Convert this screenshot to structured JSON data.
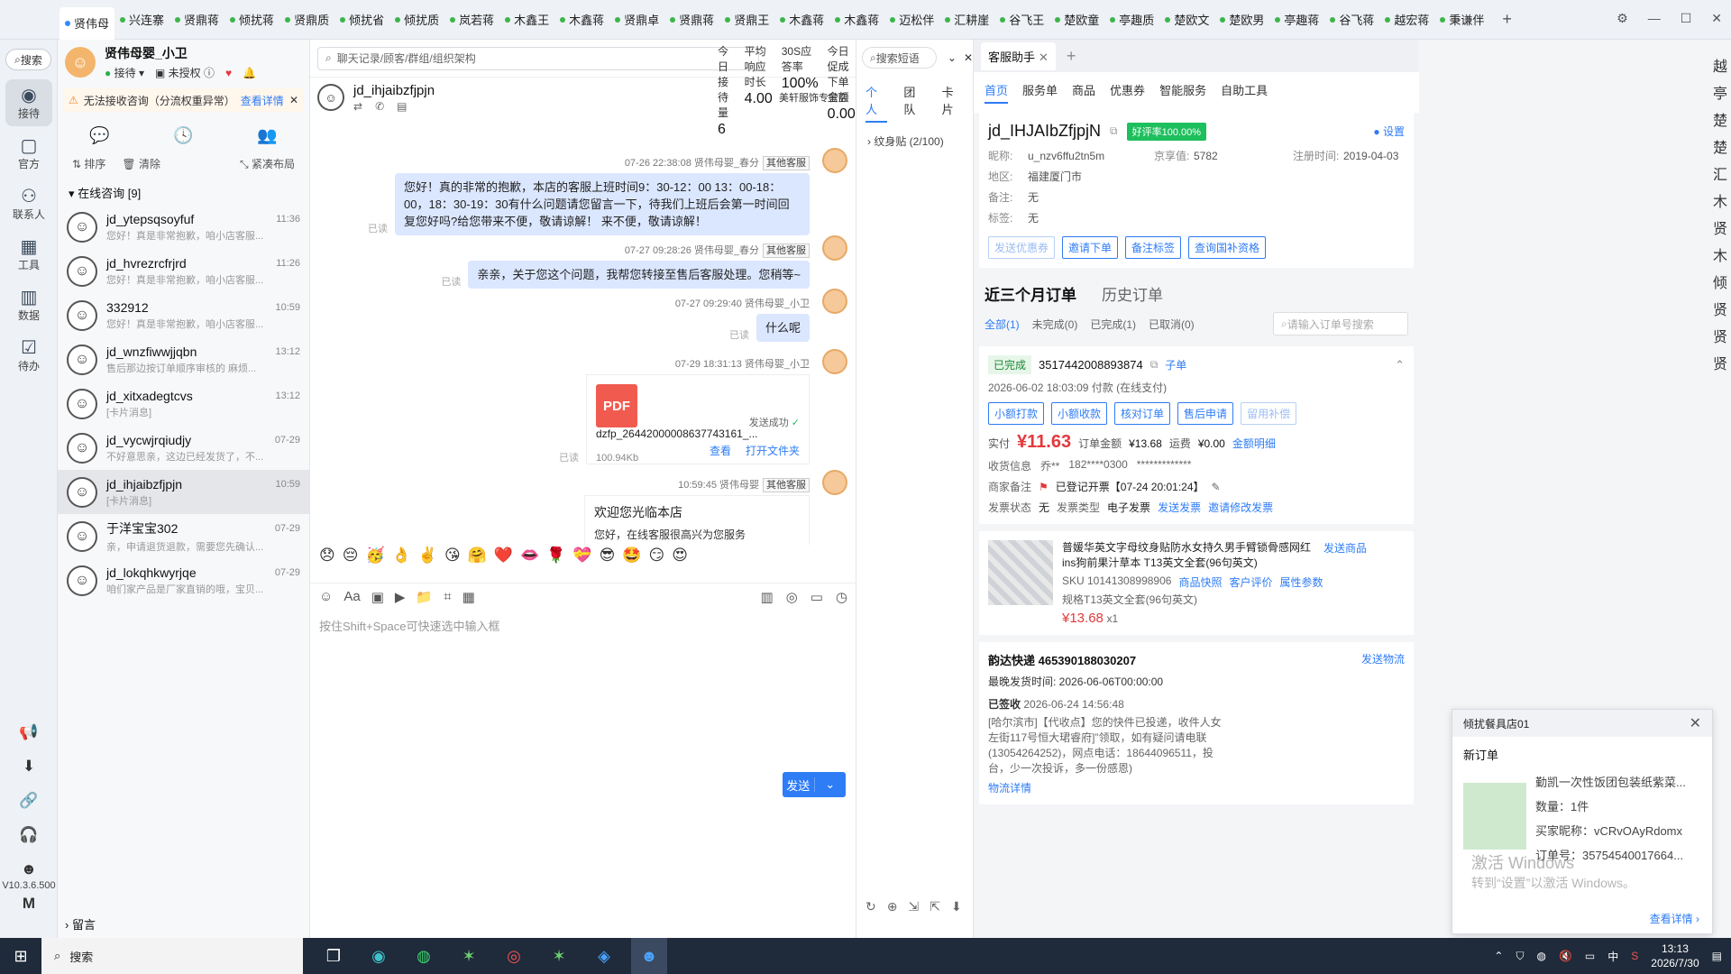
{
  "top_tabs": [
    "贤伟母",
    "兴连寨",
    "贤鼎蒋",
    "倾扰蒋",
    "贤鼎质",
    "倾扰省",
    "倾扰质",
    "岚若蒋",
    "木鑫王",
    "木鑫蒋",
    "贤鼎卓",
    "贤鼎蒋",
    "贤鼎王",
    "木鑫蒋",
    "木鑫蒋",
    "迈松伴",
    "汇耕崖",
    "谷飞王",
    "楚欧童",
    "亭趣质",
    "楚欧文",
    "楚欧男",
    "亭趣蒋",
    "谷飞蒋",
    "越宏蒋",
    "秉谦伴"
  ],
  "nav": {
    "search": "搜索",
    "items": [
      {
        "label": "接待",
        "icon": "chat-bubble-icon"
      },
      {
        "label": "官方",
        "icon": "message-icon"
      },
      {
        "label": "联系人",
        "icon": "person-icon"
      },
      {
        "label": "工具",
        "icon": "grid-icon"
      },
      {
        "label": "数据",
        "icon": "bar-chart-icon"
      },
      {
        "label": "待办",
        "icon": "checkbox-icon"
      }
    ],
    "version": "V10.3.6.500"
  },
  "me": {
    "name": "贤伟母婴_小卫",
    "status": "接待",
    "auth": "未授权"
  },
  "warning": {
    "text": "无法接收咨询（分流权重异常）",
    "link": "查看详情"
  },
  "list_tools": {
    "sort": "排序",
    "clear": "清除",
    "layout": "紧凑布局"
  },
  "online_group": "在线咨询 [9]",
  "conversations": [
    {
      "name": "jd_ytepsqsoyfuf",
      "time": "11:36",
      "preview": "您好！真是非常抱歉，咱小店客服..."
    },
    {
      "name": "jd_hvrezrcfrjrd",
      "time": "11:26",
      "preview": "您好！真是非常抱歉，咱小店客服..."
    },
    {
      "name": "332912",
      "time": "10:59",
      "preview": "您好！真是非常抱歉，咱小店客服..."
    },
    {
      "name": "jd_wnzfiwwjjqbn",
      "time": "13:12",
      "preview": "售后那边按订单顺序审核的 麻烦..."
    },
    {
      "name": "jd_xitxadegtcvs",
      "time": "13:12",
      "preview": "[卡片消息]"
    },
    {
      "name": "jd_vycwjrqiudjy",
      "time": "07-29",
      "preview": "不好意思亲，这边已经发货了，不..."
    },
    {
      "name": "jd_ihjaibzfjpjn",
      "time": "10:59",
      "preview": "[卡片消息]"
    },
    {
      "name": "于洋宝宝302",
      "time": "07-29",
      "preview": "亲，申请退货退款，需要您先确认..."
    },
    {
      "name": "jd_lokqhkwyrjqe",
      "time": "07-29",
      "preview": "咱们家产品是厂家直销的哦，宝贝..."
    }
  ],
  "leave_msg": "留言",
  "chat": {
    "search_placeholder": "聊天记录/顾客/群组/组织架构",
    "stats": [
      {
        "k": "今日接待量",
        "v": "6"
      },
      {
        "k": "平均响应时长",
        "v": "4.00"
      },
      {
        "k": "30S应答率",
        "v": "100%"
      },
      {
        "k": "今日促成下单金额",
        "v": "0.00"
      }
    ],
    "customer": "jd_ihjaibzfjpjn",
    "shop": "美轩服饰专营店",
    "messages": [
      {
        "meta": "07-26 22:38:08  贤伟母婴_春分",
        "tag": "其他客服",
        "text": "您好！真的非常的抱歉，本店的客服上班时间9：30-12：00  13：00-18：00，18：30-19：30有什么问题请您留言一下，待我们上班后会第一时间回复您好吗?给您带来不便，敬请谅解！  来不便，敬请谅解！",
        "read": "已读"
      },
      {
        "meta": "07-27 09:28:26  贤伟母婴_春分",
        "tag": "其他客服",
        "text": "亲亲，关于您这个问题，我帮您转接至售后客服处理。您稍等~",
        "read": "已读"
      },
      {
        "meta": "07-27 09:29:40  贤伟母婴_小卫",
        "tag": "",
        "text": "什么呢",
        "read": "已读"
      }
    ],
    "file_msg": {
      "meta": "07-29 18:31:13  贤伟母婴_小卫",
      "name": "dzfp_26442000008637743161_...",
      "size": "100.94Kb",
      "status": "发送成功",
      "view": "查看",
      "open": "打开文件夹",
      "read": "已读"
    },
    "welcome_msg": {
      "meta": "10:59:45  贤伟母婴",
      "tag": "其他客服",
      "title": "欢迎您光临本店",
      "sub": "您好，在线客服很高兴为您服务"
    },
    "emojis": [
      "😞",
      "😔",
      "🥳",
      "👌",
      "✌️",
      "😘",
      "🤗",
      "❤️",
      "👄",
      "🌹",
      "💝",
      "😎",
      "🤩",
      "😏",
      "😍"
    ],
    "input_placeholder": "按住Shift+Space可快速选中输入框",
    "send": "发送"
  },
  "phrase": {
    "search": "搜索短语",
    "tabs": [
      "个人",
      "团队",
      "卡片"
    ],
    "group": "纹身贴 (2/100)"
  },
  "assistant": {
    "tab": "客服助手",
    "nav": [
      "首页",
      "服务单",
      "商品",
      "优惠券",
      "智能服务",
      "自助工具"
    ],
    "customer_id": "jd_IHJAIbZfjpjN",
    "rating": "好评率100.00%",
    "settings": "设置",
    "nickname": "u_nzv6ffu2tn5m",
    "jingxiang": "5782",
    "reg_time": "2019-04-03",
    "region": "福建厦门市",
    "remark": "无",
    "tags": "无",
    "actions": [
      "发送优惠券",
      "邀请下单",
      "备注标签",
      "查询国补资格"
    ],
    "orders_title": "近三个月订单",
    "history_title": "历史订单",
    "filters": [
      "全部(1)",
      "未完成(0)",
      "已完成(1)",
      "已取消(0)"
    ],
    "order_search": "请输入订单号搜索",
    "order": {
      "status": "已完成",
      "id": "3517442008893874",
      "sub": "子单",
      "pay_time": "2026-06-02 18:03:09 付款 (在线支付)",
      "btns": [
        "小额打款",
        "小额收款",
        "核对订单",
        "售后申请",
        "留用补偿"
      ],
      "paid": "¥11.63",
      "total": "¥13.68",
      "freight": "¥0.00",
      "detail": "金额明细",
      "receiver": "乔**",
      "phone": "182****0300",
      "address": "*************",
      "merchant_note": "已登记开票【07-24 20:01:24】",
      "invoice_status": "无",
      "invoice_type": "电子发票",
      "send_invoice": "发送发票",
      "invite_invoice": "邀请修改发票",
      "goods_name": "普媛华英文字母纹身贴防水女持久男手臂锁骨感网红ins狗前果汁草本 T13英文全套(96句英文)",
      "sku": "SKU 10141308998906",
      "goods_links": [
        "商品快照",
        "客户评价",
        "属性参数"
      ],
      "spec": "规格T13英文全套(96句英文)",
      "goods_price": "¥13.68",
      "qty": "x1",
      "send_goods": "发送商品",
      "express": "韵达快递 465390188030207",
      "send_logistics": "发送物流",
      "last_ship": "最晚发货时间:  2026-06-06T00:00:00",
      "signed": "已签收",
      "signed_time": "2026-06-24 14:56:48",
      "logistics_text": "[哈尔滨市]【代收点】您的快件已投递，收件人女左街117号恒大珺睿府]”领取，如有疑问请电联(13054264252)，网点电话：18644096511，投台，少一次投诉，多一份感恩)",
      "logistics_link": "物流详情"
    }
  },
  "notify": {
    "title": "倾扰餐具店01",
    "type": "新订单",
    "goods": "勤凯一次性饭团包装纸紫菜...",
    "qty": "数量：1件",
    "buyer": "买家昵称：vCRvOAyRdomx",
    "order_no": "订单号：35754540017664...",
    "more": "查看详情"
  },
  "watermark": {
    "title": "激活 Windows",
    "sub": "转到“设置”以激活 Windows。"
  },
  "right_strip": [
    "越",
    "亭",
    "楚",
    "楚",
    "汇",
    "木",
    "贤",
    "木",
    "倾",
    "贤",
    "贤",
    "贤"
  ],
  "taskbar": {
    "search": "搜索",
    "time": "13:13",
    "date": "2026/7/30",
    "ime": "中"
  }
}
